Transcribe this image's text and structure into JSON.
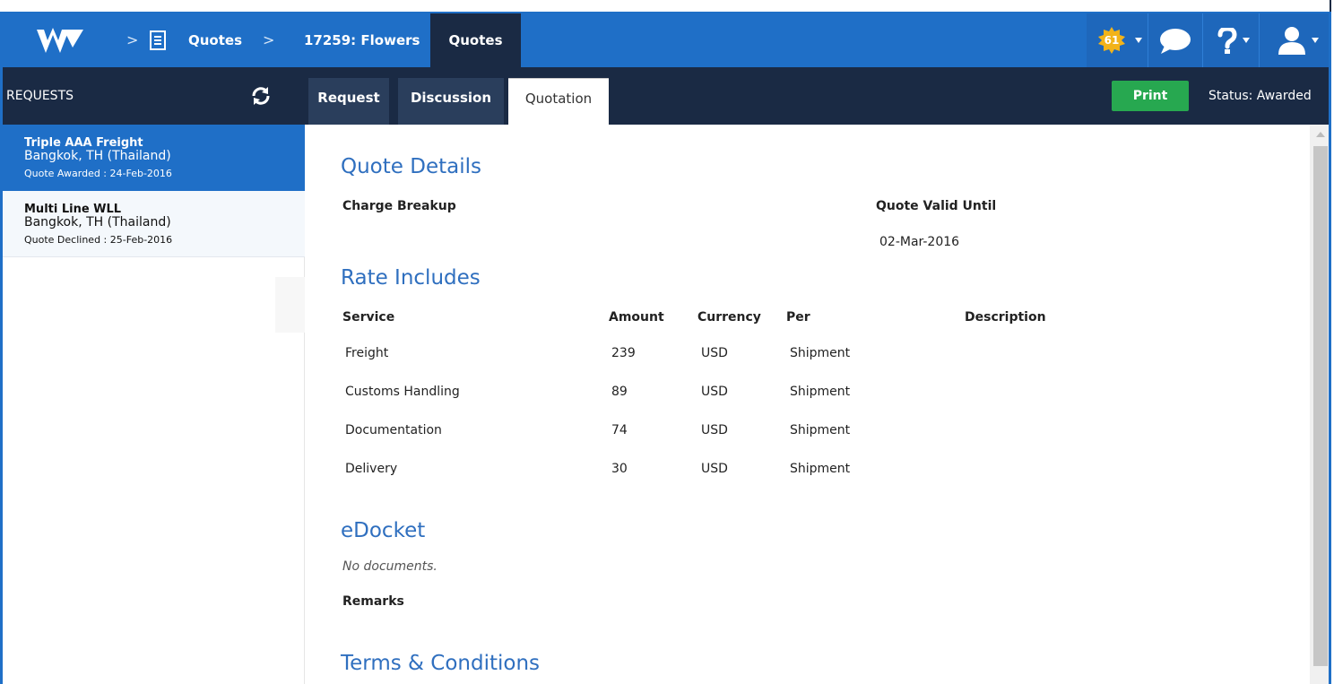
{
  "topbar": {
    "breadcrumbs": [
      "Quotes",
      "17259: Flowers"
    ],
    "separator": ">",
    "active_crumb": "Quotes",
    "notification_count": "61"
  },
  "sidebar": {
    "title": "REQUESTS",
    "requests": [
      {
        "name": "Triple AAA Freight",
        "location": "Bangkok, TH (Thailand)",
        "status": "Quote Awarded : 24-Feb-2016"
      },
      {
        "name": "Multi Line WLL",
        "location": "Bangkok, TH (Thailand)",
        "status": "Quote Declined : 25-Feb-2016"
      }
    ]
  },
  "tabs": [
    "Request",
    "Discussion",
    "Quotation"
  ],
  "actions": {
    "print_label": "Print",
    "status": "Status: Awarded"
  },
  "quote_details": {
    "heading": "Quote Details",
    "charge_breakup_label": "Charge Breakup",
    "valid_until_label": "Quote Valid Until",
    "valid_until_value": "02-Mar-2016"
  },
  "rate_includes": {
    "heading": "Rate Includes",
    "columns": [
      "Service",
      "Amount",
      "Currency",
      "Per",
      "Description"
    ],
    "rows": [
      {
        "service": "Freight",
        "amount": "239",
        "currency": "USD",
        "per": "Shipment"
      },
      {
        "service": "Customs Handling",
        "amount": "89",
        "currency": "USD",
        "per": "Shipment"
      },
      {
        "service": "Documentation",
        "amount": "74",
        "currency": "USD",
        "per": "Shipment"
      },
      {
        "service": "Delivery",
        "amount": "30",
        "currency": "USD",
        "per": "Shipment"
      }
    ]
  },
  "edocket": {
    "heading": "eDocket",
    "empty_text": "No documents.",
    "remarks_label": "Remarks"
  },
  "terms": {
    "heading": "Terms & Conditions"
  },
  "colors": {
    "primary": "#1f6fc7",
    "dark": "#1a2a44",
    "print_green": "#27a850",
    "heading_blue": "#2f6fbf"
  },
  "icons": [
    "logo-w-icon",
    "document-icon",
    "notification-badge-icon",
    "chat-icon",
    "help-icon",
    "user-icon",
    "refresh-icon"
  ]
}
